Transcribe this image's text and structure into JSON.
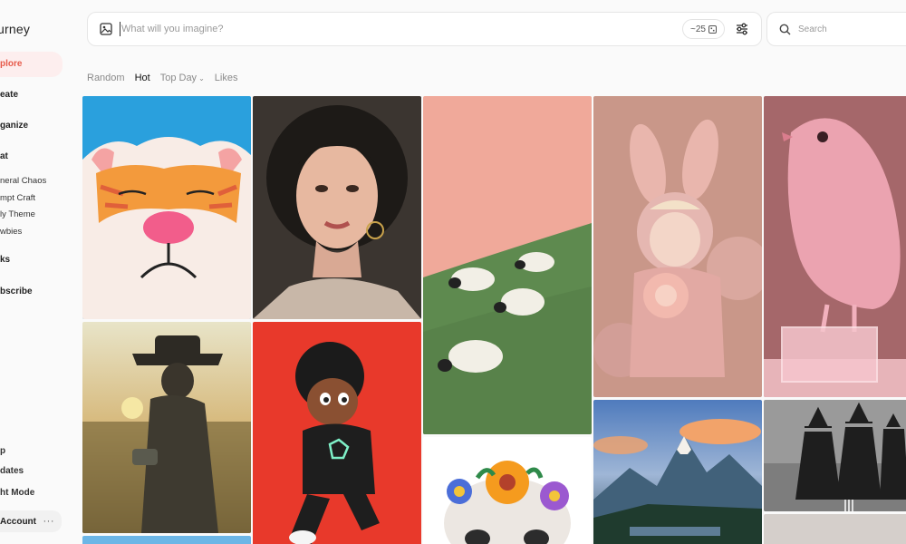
{
  "sidebar": {
    "brand": "urney",
    "nav": [
      {
        "label": "plore",
        "active": true
      },
      {
        "label": "eate"
      },
      {
        "label": "ganize"
      },
      {
        "label": "at"
      }
    ],
    "channels": [
      "neral Chaos",
      "mpt Craft",
      "ly Theme",
      "wbies"
    ],
    "nav2": [
      "ks",
      "bscribe"
    ],
    "footer": [
      "p",
      "dates",
      "ht Mode"
    ],
    "account": {
      "label": "Account",
      "menu": "···"
    }
  },
  "prompt": {
    "placeholder": "What will you imagine?",
    "credits": "~25",
    "icons": {
      "image": "image-icon",
      "settings": "sliders-icon",
      "credit": "grid-icon"
    }
  },
  "search": {
    "placeholder": "Search",
    "icon": "search-icon"
  },
  "tabs": [
    {
      "label": "Random"
    },
    {
      "label": "Hot",
      "active": true
    },
    {
      "label": "Top Day",
      "chevron": "⌄"
    },
    {
      "label": "Likes"
    }
  ],
  "colors": {
    "accent": "#e65a4a",
    "accent_bg": "#fdeeee"
  }
}
